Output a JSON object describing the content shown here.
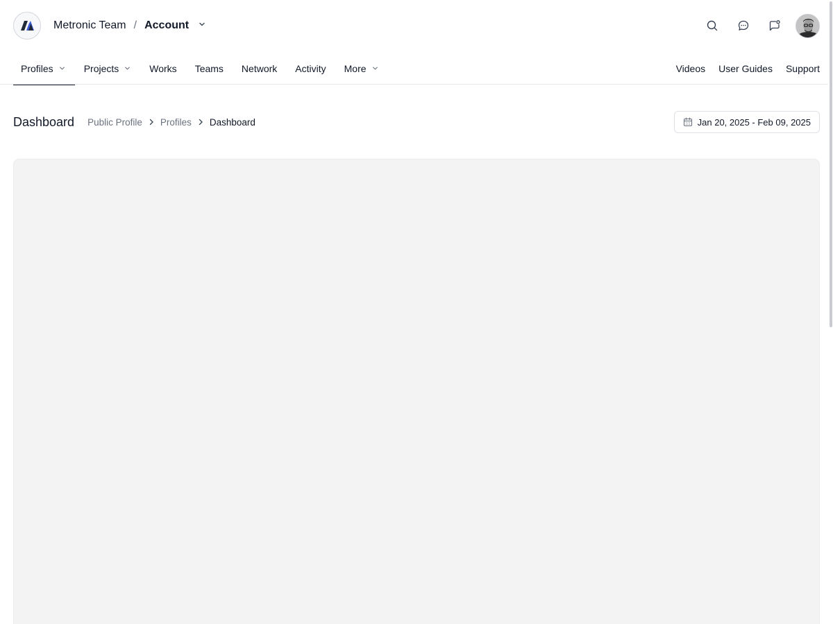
{
  "header": {
    "team_name": "Metronic Team",
    "separator": "/",
    "account_label": "Account",
    "icons": [
      "search-icon",
      "messages-icon",
      "notifications-icon"
    ],
    "avatar_alt": "User avatar"
  },
  "menu": {
    "items": [
      {
        "label": "Profiles",
        "has_dropdown": true,
        "active": true
      },
      {
        "label": "Projects",
        "has_dropdown": true
      },
      {
        "label": "Works"
      },
      {
        "label": "Teams"
      },
      {
        "label": "Network"
      },
      {
        "label": "Activity"
      },
      {
        "label": "More",
        "has_dropdown": true
      }
    ],
    "right_items": [
      {
        "label": "Videos"
      },
      {
        "label": "User Guides"
      },
      {
        "label": "Support"
      }
    ]
  },
  "toolbar": {
    "title": "Dashboard",
    "breadcrumb": [
      "Public Profile",
      "Profiles",
      "Dashboard"
    ],
    "date_range": "Jan 20, 2025 - Feb 09, 2025"
  },
  "colors": {
    "text": "#111827",
    "muted": "#6b7280",
    "content_bg": "#f3f3f4"
  }
}
